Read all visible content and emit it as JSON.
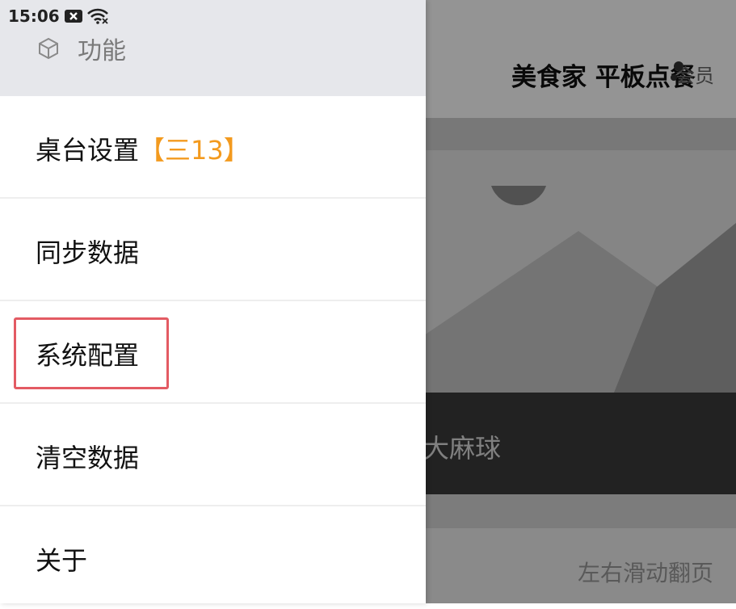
{
  "background": {
    "app_title": "美食家 平板点餐",
    "member_label": "会员",
    "dish_name": "大麻球",
    "swipe_hint": "左右滑动翻页"
  },
  "status_bar": {
    "time": "15:06",
    "icons": [
      "notification-x-icon",
      "wifi-icon"
    ]
  },
  "drawer": {
    "header_icon": "cube-icon",
    "header_title": "功能",
    "items": [
      {
        "label": "桌台设置",
        "badge": "【三13】"
      },
      {
        "label": "同步数据"
      },
      {
        "label": "系统配置",
        "highlighted": true
      },
      {
        "label": "清空数据"
      },
      {
        "label": "关于"
      }
    ]
  },
  "colors": {
    "accent_orange": "#f39a1e",
    "highlight_red": "#e35b63",
    "header_bg": "#e6e7eb"
  }
}
